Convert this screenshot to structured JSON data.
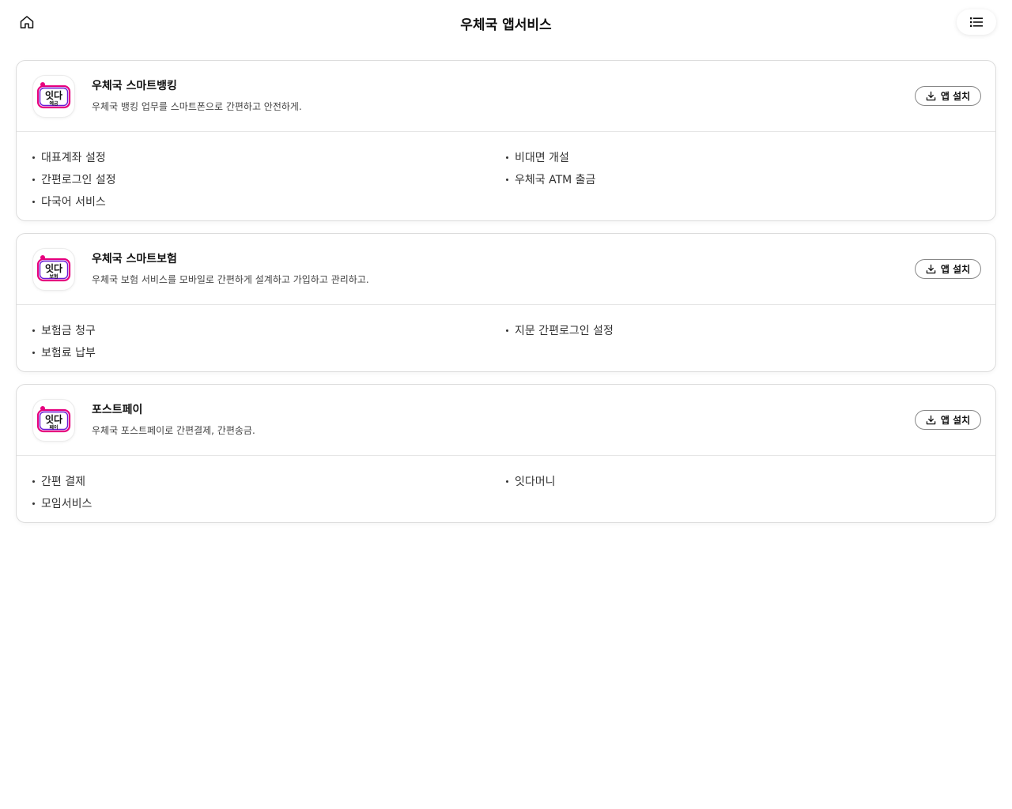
{
  "header": {
    "title": "우체국 앱서비스",
    "home_icon": "home-icon",
    "menu_icon": "list-icon"
  },
  "install_label": "앱 설치",
  "apps": [
    {
      "name": "우체국 스마트뱅킹",
      "desc": "우체국 뱅킹 업무를 스마트폰으로 간편하고 안전하게.",
      "icon_text": "잇다",
      "icon_sub": "예금",
      "features": [
        "대표계좌 설정",
        "비대면 개설",
        "간편로그인 설정",
        "우체국 ATM 출금",
        "다국어 서비스"
      ]
    },
    {
      "name": "우체국 스마트보험",
      "desc": "우체국 보험 서비스를 모바일로 간편하게 설계하고 가입하고 관리하고.",
      "icon_text": "잇다",
      "icon_sub": "보험",
      "features": [
        "보험금 청구",
        "지문 간편로그인 설정",
        "보험료 납부"
      ]
    },
    {
      "name": "포스트페이",
      "desc": "우체국 포스트페이로 간편결제, 간편송금.",
      "icon_text": "잇다",
      "icon_sub": "페이",
      "features": [
        "간편 결제",
        "잇다머니",
        "모임서비스"
      ]
    }
  ],
  "colors": {
    "logo_pink": "#e6007e",
    "logo_purple": "#6a1bd6",
    "logo_teal": "#19b6c9",
    "border": "#dcdcdc"
  }
}
